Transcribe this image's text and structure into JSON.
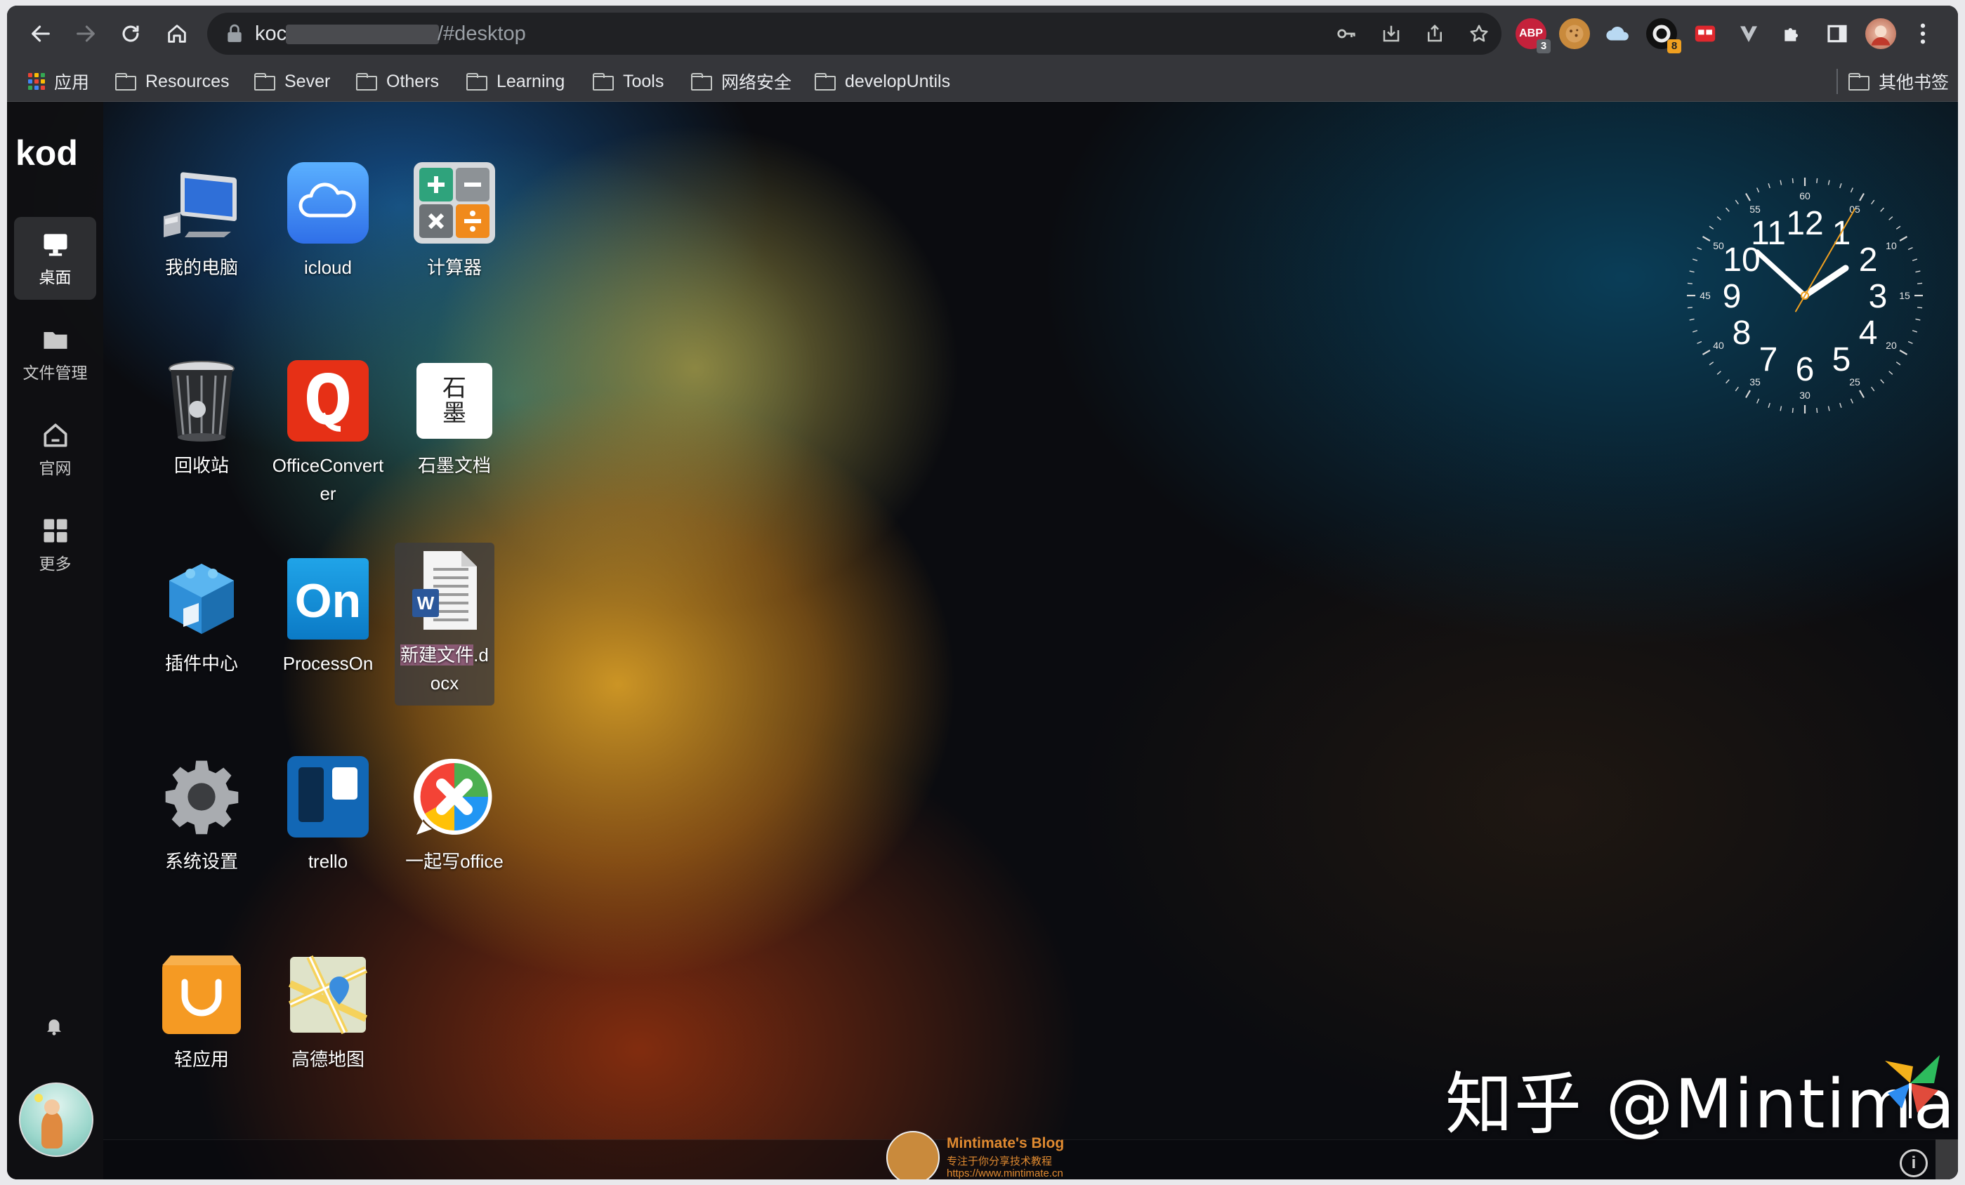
{
  "browser": {
    "url_host": "koc",
    "url_path": "/#desktop",
    "extensions": [
      {
        "name": "adblock",
        "label": "ABP",
        "badge": "3"
      },
      {
        "name": "cookie",
        "label": ""
      },
      {
        "name": "cloud",
        "label": ""
      },
      {
        "name": "ext-dark",
        "label": "",
        "badge": "8"
      },
      {
        "name": "ext-red",
        "label": ""
      },
      {
        "name": "ext-v",
        "label": ""
      }
    ]
  },
  "bookmarks": {
    "apps": "应用",
    "items": [
      "Resources",
      "Sever",
      "Others",
      "Learning",
      "Tools",
      "网络安全",
      "developUntils"
    ],
    "other": "其他书签"
  },
  "sidebar": {
    "logo": "kod",
    "items": [
      {
        "label": "桌面",
        "active": true
      },
      {
        "label": "文件管理"
      },
      {
        "label": "官网"
      },
      {
        "label": "更多"
      }
    ]
  },
  "desktop": {
    "icons": [
      {
        "label": "我的电脑",
        "icon": "computer-icon"
      },
      {
        "label": "icloud",
        "icon": "icloud-icon"
      },
      {
        "label": "计算器",
        "icon": "calculator-icon"
      },
      {
        "label": "回收站",
        "icon": "recycle-bin-icon"
      },
      {
        "label": "OfficeConverter",
        "icon": "office-converter-icon"
      },
      {
        "label": "石墨文档",
        "icon": "shimo-icon",
        "glyph": "石\n墨"
      },
      {
        "label": "插件中心",
        "icon": "plugin-center-icon"
      },
      {
        "label": "ProcessOn",
        "icon": "processon-icon",
        "glyph": "On"
      },
      {
        "label_selected": "新建文件",
        "label_suffix": ".docx",
        "icon": "word-document-icon",
        "selected": true
      },
      {
        "label": "系统设置",
        "icon": "settings-gear-icon"
      },
      {
        "label": "trello",
        "icon": "trello-icon"
      },
      {
        "label": "一起写office",
        "icon": "yiqixie-icon"
      },
      {
        "label": "轻应用",
        "icon": "light-app-icon"
      },
      {
        "label": "高德地图",
        "icon": "amap-icon"
      }
    ]
  },
  "clock": {
    "hour_numbers": [
      "12",
      "1",
      "2",
      "3",
      "4",
      "5",
      "6",
      "7",
      "8",
      "9",
      "10",
      "11"
    ],
    "minute_numbers": [
      "60",
      "05",
      "10",
      "15",
      "20",
      "25",
      "30",
      "35",
      "40",
      "45",
      "50",
      "55"
    ],
    "time_shown": "1:52:05",
    "second_hand_color": "#f0a020"
  },
  "watermark": {
    "zhihu": "知乎 @Mintimate",
    "blog_title": "Mintimate's Blog",
    "blog_subtitle": "专注于你分享技术教程",
    "blog_url": "https://www.mintimate.cn"
  },
  "colors": {
    "browser_chrome": "#35363a",
    "omnibox": "#202124",
    "selection": "#8a5a74",
    "accent_orange": "#f0a020"
  }
}
